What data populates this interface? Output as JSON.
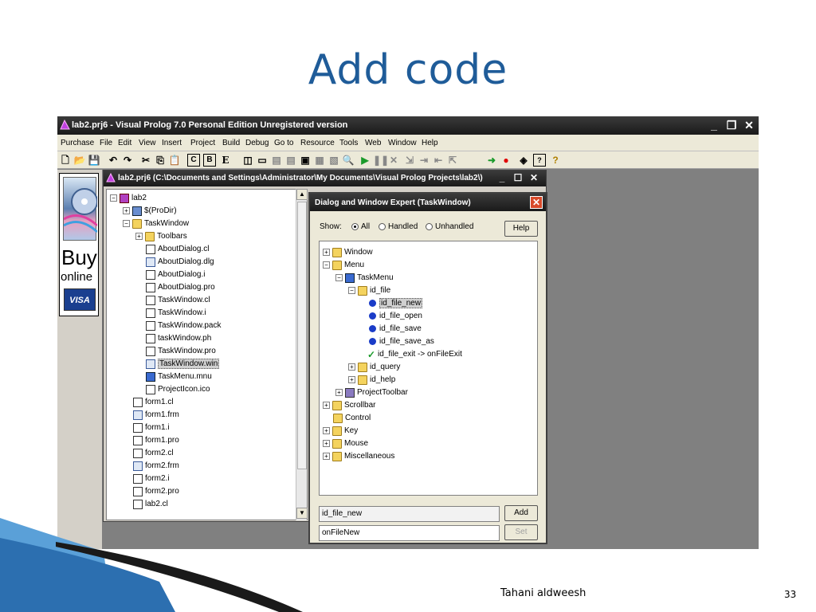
{
  "slide": {
    "title": "Add code",
    "author": "Tahani aldweesh",
    "page_number": "33"
  },
  "app": {
    "title": "lab2.prj6 - Visual Prolog 7.0 Personal Edition Unregistered version",
    "menu": [
      "Purchase",
      "File",
      "Edit",
      "View",
      "Insert",
      "Project",
      "Build",
      "Debug",
      "Go to",
      "Resource",
      "Tools",
      "Web",
      "Window",
      "Help"
    ],
    "window_buttons": [
      "_",
      "❐",
      "✕"
    ]
  },
  "buy_panel": {
    "buy": "Buy",
    "online": "online",
    "card": "VISA"
  },
  "project_window": {
    "title": "lab2.prj6 (C:\\Documents and Settings\\Administrator\\My Documents\\Visual Prolog Projects\\lab2\\)",
    "root": "lab2",
    "prodir": "$(ProDir)",
    "taskwindow": "TaskWindow",
    "toolbars": "Toolbars",
    "children": [
      "AboutDialog.cl",
      "AboutDialog.dlg",
      "AboutDialog.i",
      "AboutDialog.pro",
      "TaskWindow.cl",
      "TaskWindow.i",
      "TaskWindow.pack",
      "taskWindow.ph",
      "TaskWindow.pro",
      "TaskWindow.win",
      "TaskMenu.mnu",
      "ProjectIcon.ico"
    ],
    "files": [
      "form1.cl",
      "form1.frm",
      "form1.i",
      "form1.pro",
      "form2.cl",
      "form2.frm",
      "form2.i",
      "form2.pro",
      "lab2.cl"
    ]
  },
  "dialog": {
    "title": "Dialog and Window Expert (TaskWindow)",
    "show_label": "Show:",
    "radio_all": "All",
    "radio_handled": "Handled",
    "radio_unhandled": "Unhandled",
    "help_label": "Help",
    "tree": {
      "window": "Window",
      "menu": "Menu",
      "taskmenu": "TaskMenu",
      "id_file": "id_file",
      "file_items": [
        "id_file_new",
        "id_file_open",
        "id_file_save",
        "id_file_save_as"
      ],
      "exit_item": "id_file_exit -> onFileExit",
      "id_query": "id_query",
      "id_help": "id_help",
      "project_toolbar": "ProjectToolbar",
      "others": [
        "Scrollbar",
        "Control",
        "Key",
        "Mouse",
        "Miscellaneous"
      ]
    },
    "field_id": "id_file_new",
    "add_label": "Add",
    "field_handler": "onFileNew",
    "set_label": "Set"
  }
}
